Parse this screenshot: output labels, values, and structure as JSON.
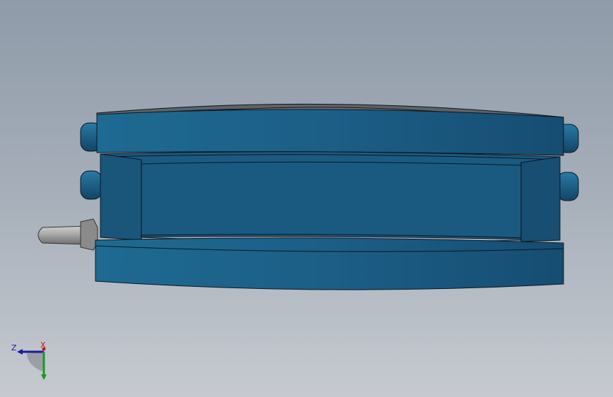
{
  "viewport": {
    "background_top": "#8f9ba9",
    "background_bottom": "#c6cad0"
  },
  "model": {
    "part_color": "#1d5f86",
    "part_shadow": "#11425f",
    "edge_color": "#0b1620",
    "shaft_color": "#9a9a9a",
    "top_face_color": "#5f6368"
  },
  "triad": {
    "z_label": "Z",
    "x_label": "X",
    "z_color": "#1a1ab0",
    "y_color": "#1a9a1a",
    "x_color": "#c01818"
  }
}
